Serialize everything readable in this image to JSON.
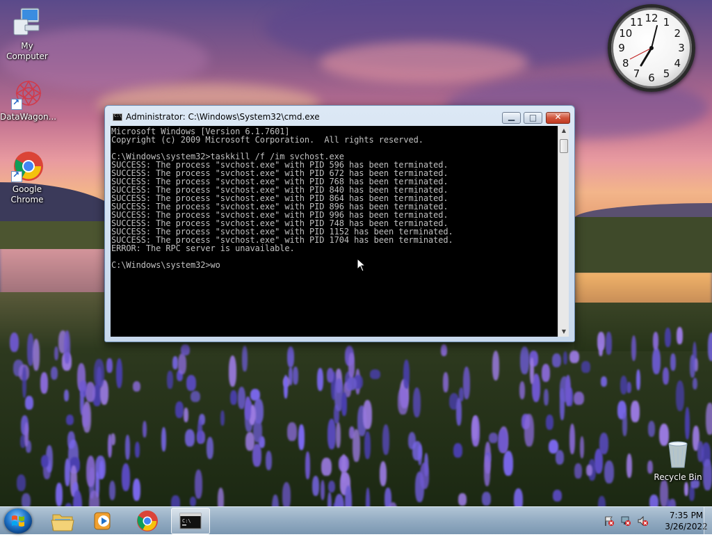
{
  "desktop": {
    "icons": [
      {
        "label": "My Computer",
        "icon": "computer-icon"
      },
      {
        "label": "DataWagon...",
        "icon": "datawagon-icon"
      },
      {
        "label": "Google\nChrome",
        "icon": "chrome-icon"
      },
      {
        "label": "Recycle Bin",
        "icon": "recycle-bin-icon"
      }
    ]
  },
  "clock_gadget": {
    "numbers": [
      "12",
      "1",
      "2",
      "3",
      "4",
      "5",
      "6",
      "7",
      "8",
      "9",
      "10",
      "11"
    ]
  },
  "cmd": {
    "title": "Administrator: C:\\Windows\\System32\\cmd.exe",
    "buttons": {
      "minimize": "minimize-icon",
      "maximize": "maximize-icon",
      "close": "close-icon"
    },
    "lines": [
      "Microsoft Windows [Version 6.1.7601]",
      "Copyright (c) 2009 Microsoft Corporation.  All rights reserved.",
      "",
      "C:\\Windows\\system32>taskkill /f /im svchost.exe",
      "SUCCESS: The process \"svchost.exe\" with PID 596 has been terminated.",
      "SUCCESS: The process \"svchost.exe\" with PID 672 has been terminated.",
      "SUCCESS: The process \"svchost.exe\" with PID 768 has been terminated.",
      "SUCCESS: The process \"svchost.exe\" with PID 840 has been terminated.",
      "SUCCESS: The process \"svchost.exe\" with PID 864 has been terminated.",
      "SUCCESS: The process \"svchost.exe\" with PID 896 has been terminated.",
      "SUCCESS: The process \"svchost.exe\" with PID 996 has been terminated.",
      "SUCCESS: The process \"svchost.exe\" with PID 748 has been terminated.",
      "SUCCESS: The process \"svchost.exe\" with PID 1152 has been terminated.",
      "SUCCESS: The process \"svchost.exe\" with PID 1704 has been terminated.",
      "ERROR: The RPC server is unavailable.",
      "",
      "C:\\Windows\\system32>wo"
    ]
  },
  "taskbar": {
    "items": [
      "explorer-icon",
      "media-player-icon",
      "chrome-icon",
      "cmd-icon"
    ],
    "tray": [
      "action-center-flag-icon",
      "network-icon",
      "volume-muted-icon"
    ],
    "time": "7:35 PM",
    "date": "3/26/2022"
  },
  "colors": {
    "console_bg": "#000000",
    "console_text": "#c0c0c0",
    "close_button": "#c8452c"
  }
}
